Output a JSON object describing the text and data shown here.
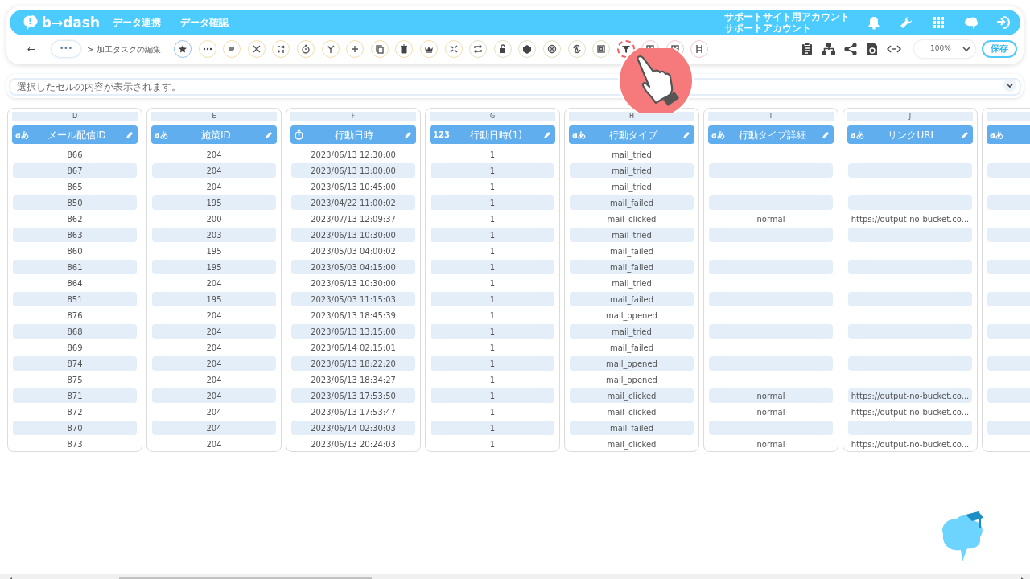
{
  "header": {
    "logo": "b→dash",
    "nav": [
      "データ連携",
      "データ確認"
    ],
    "account": [
      "サポートサイト用アカウント",
      "サポートアカウント"
    ]
  },
  "toolbar": {
    "back": "←",
    "more": "•••",
    "breadcrumb": "> 加工タスクの編集",
    "zoom": "100%",
    "save": "保存",
    "tools": [
      {
        "highlighted": false
      },
      {
        "highlighted": false
      },
      {
        "highlighted": false
      },
      {
        "highlighted": false
      },
      {
        "highlighted": false
      },
      {
        "highlighted": false
      },
      {
        "highlighted": false
      },
      {
        "highlighted": false
      },
      {
        "highlighted": false
      },
      {
        "highlighted": false
      },
      {
        "highlighted": false
      },
      {
        "highlighted": false
      },
      {
        "highlighted": false
      },
      {
        "highlighted": false
      },
      {
        "highlighted": false
      },
      {
        "highlighted": false
      },
      {
        "highlighted": false
      },
      {
        "highlighted": false
      },
      {
        "highlighted": true
      },
      {
        "highlighted": false
      },
      {
        "highlighted": false
      },
      {
        "highlighted": false
      }
    ]
  },
  "cell_bar": {
    "placeholder": "選択したセルの内容が表示されます。"
  },
  "columns": [
    {
      "letter": "D",
      "kind": "text",
      "type_label": "aあ",
      "name": "メール配信ID",
      "cells": [
        "866",
        "867",
        "865",
        "850",
        "862",
        "863",
        "860",
        "861",
        "864",
        "851",
        "876",
        "868",
        "869",
        "874",
        "875",
        "871",
        "872",
        "870",
        "873"
      ]
    },
    {
      "letter": "E",
      "kind": "text",
      "type_label": "aあ",
      "name": "施策ID",
      "cells": [
        "204",
        "204",
        "204",
        "195",
        "200",
        "203",
        "195",
        "195",
        "204",
        "195",
        "204",
        "204",
        "204",
        "204",
        "204",
        "204",
        "204",
        "204",
        "204"
      ]
    },
    {
      "letter": "F",
      "kind": "datetime",
      "name": "行動日時",
      "cells": [
        "2023/06/13 12:30:00",
        "2023/06/13 13:00:00",
        "2023/06/13 10:45:00",
        "2023/04/22 11:00:02",
        "2023/07/13 12:09:37",
        "2023/06/13 10:30:00",
        "2023/05/03 04:00:02",
        "2023/05/03 04:15:00",
        "2023/06/13 10:30:00",
        "2023/05/03 11:15:03",
        "2023/06/13 18:45:39",
        "2023/06/13 13:15:00",
        "2023/06/14 02:15:01",
        "2023/06/13 18:22:20",
        "2023/06/13 18:34:27",
        "2023/06/13 17:53:50",
        "2023/06/13 17:53:47",
        "2023/06/14 02:30:03",
        "2023/06/13 20:24:03"
      ]
    },
    {
      "letter": "G",
      "kind": "number",
      "type_label": "123",
      "name": "行動日時(1)",
      "cells": [
        "1",
        "1",
        "1",
        "1",
        "1",
        "1",
        "1",
        "1",
        "1",
        "1",
        "1",
        "1",
        "1",
        "1",
        "1",
        "1",
        "1",
        "1",
        "1"
      ]
    },
    {
      "letter": "H",
      "kind": "text",
      "type_label": "aあ",
      "name": "行動タイプ",
      "cells": [
        "mail_tried",
        "mail_tried",
        "mail_tried",
        "mail_failed",
        "mail_clicked",
        "mail_tried",
        "mail_failed",
        "mail_failed",
        "mail_tried",
        "mail_failed",
        "mail_opened",
        "mail_tried",
        "mail_failed",
        "mail_opened",
        "mail_opened",
        "mail_clicked",
        "mail_clicked",
        "mail_failed",
        "mail_clicked"
      ]
    },
    {
      "letter": "I",
      "kind": "text",
      "type_label": "aあ",
      "name": "行動タイプ詳細",
      "cells": [
        null,
        null,
        null,
        null,
        "normal",
        null,
        null,
        null,
        null,
        null,
        null,
        null,
        null,
        null,
        null,
        "normal",
        "normal",
        null,
        "normal"
      ]
    },
    {
      "letter": "J",
      "kind": "text",
      "type_label": "aあ",
      "name": "リンクURL",
      "cells": [
        null,
        null,
        null,
        null,
        "https://output-no-bucket.co...",
        null,
        null,
        null,
        null,
        null,
        null,
        null,
        null,
        null,
        null,
        "https://output-no-bucket.co...",
        "https://output-no-bucket.co...",
        null,
        "https://output-no-bucket.co..."
      ]
    },
    {
      "kind": "text",
      "type_label": "aあ",
      "cells": [
        null,
        null,
        null,
        null,
        null,
        null,
        null,
        null,
        null,
        null,
        null,
        null,
        null,
        null,
        null,
        null,
        null,
        null,
        null
      ]
    }
  ]
}
